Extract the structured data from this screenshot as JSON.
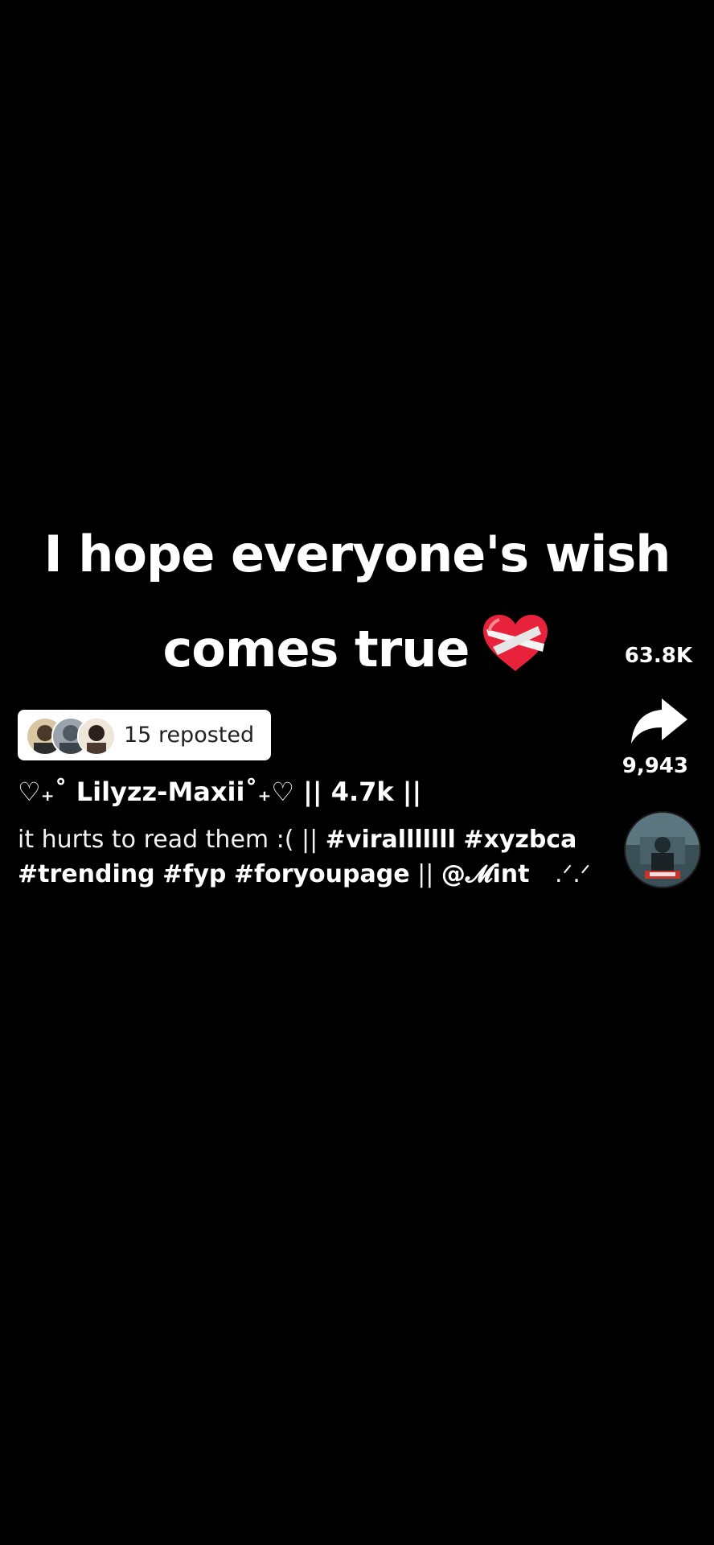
{
  "overlay": {
    "line1": "I hope everyone's wish",
    "line2": "comes true",
    "emoji": "mending-heart-emoji"
  },
  "actions": {
    "like_count": "63.8K",
    "share_count": "9,943",
    "share_icon": "share-arrow-icon",
    "sound_icon": "sound-disc-thumbnail"
  },
  "repost": {
    "label": "15 reposted"
  },
  "post": {
    "username": "♡₊˚ Lilyzz-Maxii˚₊♡ || 4.7k ||",
    "caption_text": "it hurts to read them :( ||",
    "hashtags": [
      "#viralllllll",
      "#xyzbca",
      "#trending",
      "#fyp",
      "#foryoupage"
    ],
    "separator": "||",
    "mention": "@𝓜int",
    "trailer": "⠀.ᐟ.ᐟ"
  },
  "colors": {
    "background": "#000000",
    "text": "#ffffff",
    "pill": "#ffffff",
    "heart": "#e8223a"
  }
}
